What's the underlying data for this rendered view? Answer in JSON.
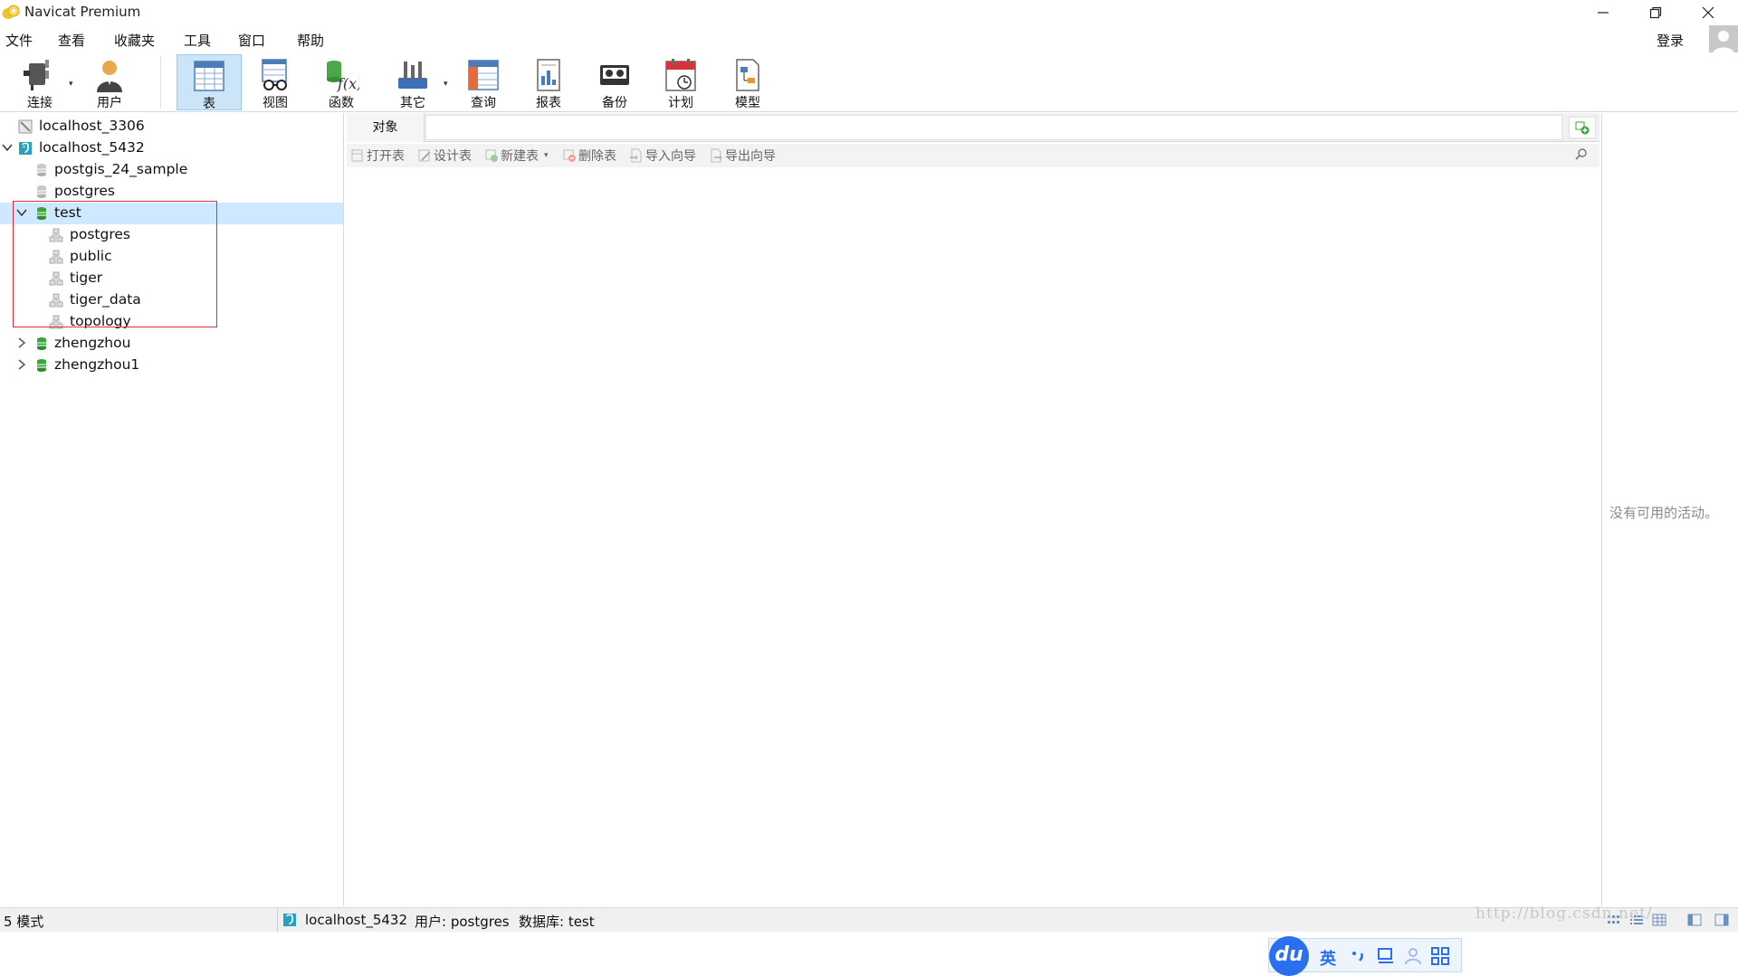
{
  "window": {
    "title": "Navicat Premium"
  },
  "menu": [
    "文件",
    "查看",
    "收藏夹",
    "工具",
    "窗口",
    "帮助"
  ],
  "account": {
    "login_label": "登录"
  },
  "toolbar": {
    "items": [
      {
        "id": "connect",
        "label": "连接",
        "icon": "plug-icon",
        "dropdown": true
      },
      {
        "id": "user",
        "label": "用户",
        "icon": "user-icon"
      },
      {
        "id": "table",
        "label": "表",
        "icon": "table-icon",
        "active": true
      },
      {
        "id": "view",
        "label": "视图",
        "icon": "view-icon"
      },
      {
        "id": "function",
        "label": "函数",
        "icon": "function-icon"
      },
      {
        "id": "other",
        "label": "其它",
        "icon": "tools-icon",
        "dropdown": true
      },
      {
        "id": "query",
        "label": "查询",
        "icon": "query-icon"
      },
      {
        "id": "report",
        "label": "报表",
        "icon": "report-icon"
      },
      {
        "id": "backup",
        "label": "备份",
        "icon": "backup-icon"
      },
      {
        "id": "schedule",
        "label": "计划",
        "icon": "calendar-icon"
      },
      {
        "id": "model",
        "label": "模型",
        "icon": "model-icon"
      }
    ]
  },
  "tree": [
    {
      "label": "localhost_3306",
      "type": "connection-mysql",
      "level": 0
    },
    {
      "label": "localhost_5432",
      "type": "connection-postgres",
      "level": 0,
      "expanded": true
    },
    {
      "label": "postgis_24_sample",
      "type": "database-closed",
      "level": 1
    },
    {
      "label": "postgres",
      "type": "database-closed",
      "level": 1
    },
    {
      "label": "test",
      "type": "database-open",
      "level": 1,
      "expanded": true,
      "selected": true
    },
    {
      "label": "postgres",
      "type": "schema",
      "level": 2
    },
    {
      "label": "public",
      "type": "schema",
      "level": 2
    },
    {
      "label": "tiger",
      "type": "schema",
      "level": 2
    },
    {
      "label": "tiger_data",
      "type": "schema",
      "level": 2
    },
    {
      "label": "topology",
      "type": "schema",
      "level": 2
    },
    {
      "label": "zhengzhou",
      "type": "database-open",
      "level": 1,
      "collapsed": true
    },
    {
      "label": "zhengzhou1",
      "type": "database-open",
      "level": 1,
      "collapsed": true
    }
  ],
  "objects": {
    "tab_label": "对象",
    "actions": [
      {
        "id": "open",
        "label": "打开表",
        "icon": "open-table-icon"
      },
      {
        "id": "design",
        "label": "设计表",
        "icon": "design-table-icon"
      },
      {
        "id": "new",
        "label": "新建表",
        "icon": "new-table-icon",
        "dropdown": true
      },
      {
        "id": "delete",
        "label": "删除表",
        "icon": "delete-table-icon"
      },
      {
        "id": "import",
        "label": "导入向导",
        "icon": "import-icon"
      },
      {
        "id": "export",
        "label": "导出向导",
        "icon": "export-icon"
      }
    ]
  },
  "ime": {
    "logo": "du",
    "mode": "英"
  },
  "activity": {
    "empty_text": "没有可用的活动。"
  },
  "status": {
    "schema_count": "5 模式",
    "connection": "localhost_5432",
    "user": "用户: postgres",
    "database": "数据库: test"
  },
  "watermark": "http://blog.csdn.net/",
  "colors": {
    "selection": "#cde8ff",
    "highlight_box": "#e0303a",
    "db_green": "#3aa53a",
    "pg_blue": "#2aa0c0"
  }
}
